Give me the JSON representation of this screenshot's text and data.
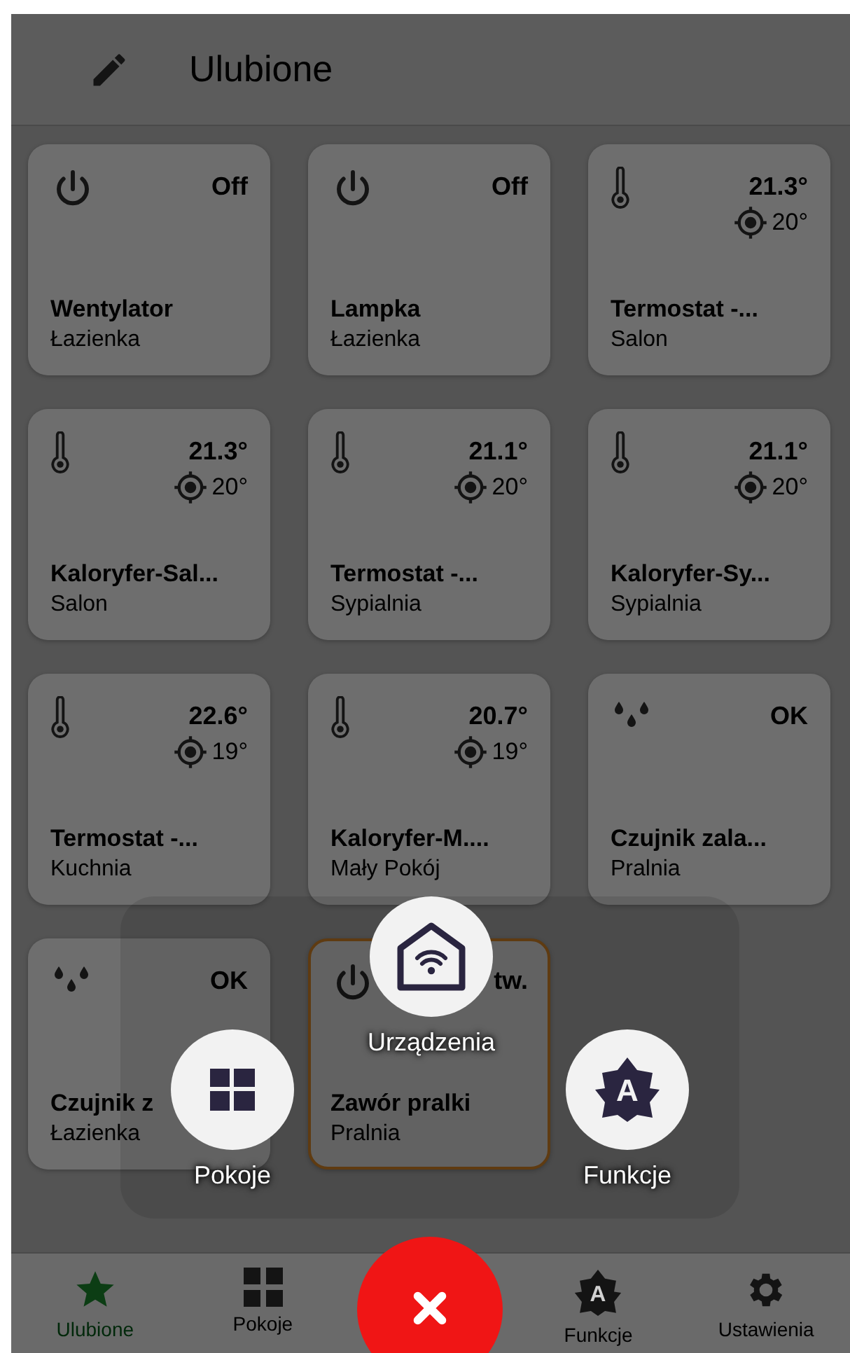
{
  "header": {
    "title": "Ulubione"
  },
  "devices": [
    {
      "kind": "switch",
      "state": "Off",
      "name": "Wentylator",
      "room": "Łazienka",
      "highlighted": false
    },
    {
      "kind": "switch",
      "state": "Off",
      "name": "Lampka",
      "room": "Łazienka",
      "highlighted": false
    },
    {
      "kind": "thermostat",
      "temperature": "21.3°",
      "target": "20°",
      "name": "Termostat -...",
      "room": "Salon",
      "highlighted": false
    },
    {
      "kind": "thermostat",
      "temperature": "21.3°",
      "target": "20°",
      "name": "Kaloryfer-Sal...",
      "room": "Salon",
      "highlighted": false
    },
    {
      "kind": "thermostat",
      "temperature": "21.1°",
      "target": "20°",
      "name": "Termostat -...",
      "room": "Sypialnia",
      "highlighted": false
    },
    {
      "kind": "thermostat",
      "temperature": "21.1°",
      "target": "20°",
      "name": "Kaloryfer-Sy...",
      "room": "Sypialnia",
      "highlighted": false
    },
    {
      "kind": "thermostat",
      "temperature": "22.6°",
      "target": "19°",
      "name": "Termostat -...",
      "room": "Kuchnia",
      "highlighted": false
    },
    {
      "kind": "thermostat",
      "temperature": "20.7°",
      "target": "19°",
      "name": "Kaloryfer-M....",
      "room": "Mały Pokój",
      "highlighted": false
    },
    {
      "kind": "flood",
      "state": "OK",
      "name": "Czujnik zala...",
      "room": "Pralnia",
      "highlighted": false
    },
    {
      "kind": "flood",
      "state": "OK",
      "name": "Czujnik z",
      "room": "Łazienka",
      "highlighted": false
    },
    {
      "kind": "switch",
      "state": "tw.",
      "name": "Zawór pralki",
      "room": "Pralnia",
      "highlighted": true
    }
  ],
  "fab_menu": [
    {
      "kind": "devices",
      "label": "Urządzenia"
    },
    {
      "kind": "rooms",
      "label": "Pokoje"
    },
    {
      "kind": "functions",
      "label": "Funkcje",
      "icon_letter": "A"
    }
  ],
  "bottom_nav": [
    {
      "kind": "favorites",
      "label": "Ulubione",
      "selected": true
    },
    {
      "kind": "rooms",
      "label": "Pokoje",
      "selected": false
    },
    {
      "kind": "fab"
    },
    {
      "kind": "functions",
      "label": "Funkcje",
      "icon_letter": "A",
      "selected": false
    },
    {
      "kind": "settings",
      "label": "Ustawienia",
      "selected": false
    }
  ]
}
